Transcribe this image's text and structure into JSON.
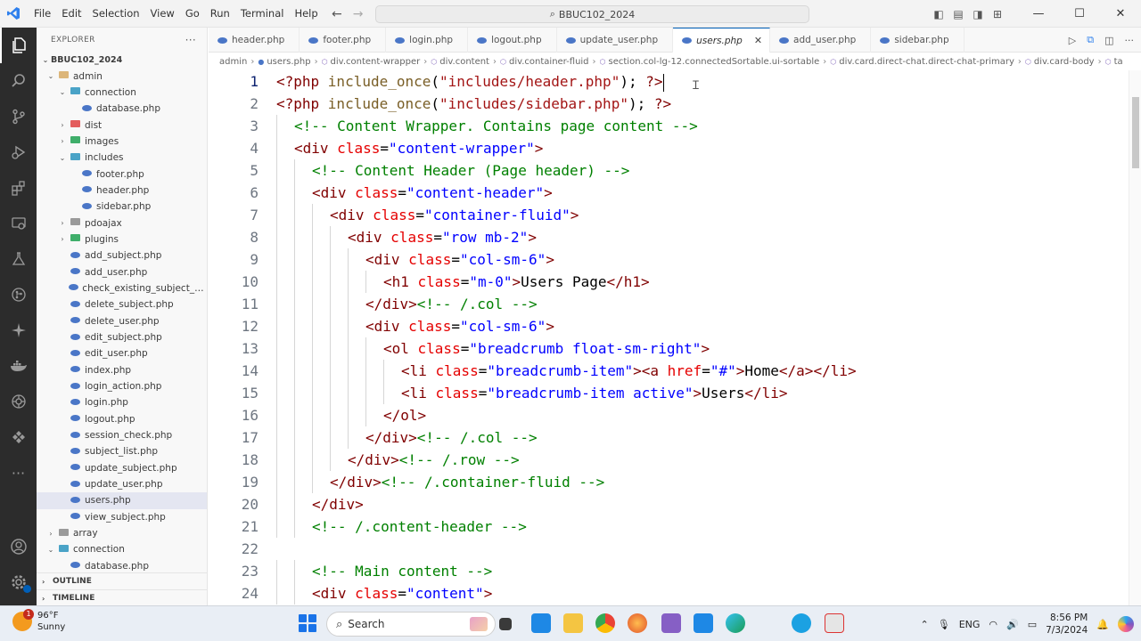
{
  "titlebar": {
    "menu": [
      "File",
      "Edit",
      "Selection",
      "View",
      "Go",
      "Run",
      "Terminal",
      "Help"
    ],
    "search_text": "BBUC102_2024"
  },
  "sidebar": {
    "title": "EXPLORER",
    "more": "···",
    "root": "BBUC102_2024",
    "tree": [
      {
        "label": "admin",
        "type": "folder-open",
        "depth": 0,
        "color": "#dcb67a"
      },
      {
        "label": "connection",
        "type": "folder-open",
        "depth": 1,
        "color": "#4aa3c7"
      },
      {
        "label": "database.php",
        "type": "php",
        "depth": 2
      },
      {
        "label": "dist",
        "type": "folder",
        "depth": 1,
        "color": "#e35d5d"
      },
      {
        "label": "images",
        "type": "folder",
        "depth": 1,
        "color": "#3fae6a"
      },
      {
        "label": "includes",
        "type": "folder-open",
        "depth": 1,
        "color": "#4aa3c7"
      },
      {
        "label": "footer.php",
        "type": "php",
        "depth": 2
      },
      {
        "label": "header.php",
        "type": "php",
        "depth": 2
      },
      {
        "label": "sidebar.php",
        "type": "php",
        "depth": 2
      },
      {
        "label": "pdoajax",
        "type": "folder",
        "depth": 1,
        "color": "#9a9a9a"
      },
      {
        "label": "plugins",
        "type": "folder",
        "depth": 1,
        "color": "#3fae6a"
      },
      {
        "label": "add_subject.php",
        "type": "php",
        "depth": 1
      },
      {
        "label": "add_user.php",
        "type": "php",
        "depth": 1
      },
      {
        "label": "check_existing_subject_cod...",
        "type": "php",
        "depth": 1
      },
      {
        "label": "delete_subject.php",
        "type": "php",
        "depth": 1
      },
      {
        "label": "delete_user.php",
        "type": "php",
        "depth": 1
      },
      {
        "label": "edit_subject.php",
        "type": "php",
        "depth": 1
      },
      {
        "label": "edit_user.php",
        "type": "php",
        "depth": 1
      },
      {
        "label": "index.php",
        "type": "php",
        "depth": 1
      },
      {
        "label": "login_action.php",
        "type": "php",
        "depth": 1
      },
      {
        "label": "login.php",
        "type": "php",
        "depth": 1
      },
      {
        "label": "logout.php",
        "type": "php",
        "depth": 1
      },
      {
        "label": "session_check.php",
        "type": "php",
        "depth": 1
      },
      {
        "label": "subject_list.php",
        "type": "php",
        "depth": 1
      },
      {
        "label": "update_subject.php",
        "type": "php",
        "depth": 1
      },
      {
        "label": "update_user.php",
        "type": "php",
        "depth": 1
      },
      {
        "label": "users.php",
        "type": "php",
        "depth": 1,
        "selected": true
      },
      {
        "label": "view_subject.php",
        "type": "php",
        "depth": 1
      },
      {
        "label": "array",
        "type": "folder",
        "depth": 0,
        "color": "#9a9a9a"
      },
      {
        "label": "connection",
        "type": "folder-open",
        "depth": 0,
        "color": "#4aa3c7"
      },
      {
        "label": "database.php",
        "type": "php",
        "depth": 1
      }
    ],
    "outline": "OUTLINE",
    "timeline": "TIMELINE"
  },
  "tabs": [
    {
      "label": "header.php"
    },
    {
      "label": "footer.php"
    },
    {
      "label": "login.php"
    },
    {
      "label": "logout.php"
    },
    {
      "label": "update_user.php"
    },
    {
      "label": "users.php",
      "active": true
    },
    {
      "label": "add_user.php"
    },
    {
      "label": "sidebar.php"
    }
  ],
  "breadcrumb": [
    "admin",
    "users.php",
    "div.content-wrapper",
    "div.content",
    "div.container-fluid",
    "section.col-lg-12.connectedSortable.ui-sortable",
    "div.card.direct-chat.direct-chat-primary",
    "div.card-body",
    "ta"
  ],
  "editor": {
    "lines": [
      {
        "n": "1",
        "indent": 0,
        "tokens": [
          [
            "php",
            "<?php "
          ],
          [
            "fn",
            "include_once"
          ],
          [
            "txt",
            "("
          ],
          [
            "str",
            "\"includes/header.php\""
          ],
          [
            "txt",
            "); "
          ],
          [
            "php",
            "?>"
          ]
        ],
        "cursor": true
      },
      {
        "n": "2",
        "indent": 0,
        "tokens": [
          [
            "php",
            "<?php "
          ],
          [
            "fn",
            "include_once"
          ],
          [
            "txt",
            "("
          ],
          [
            "str",
            "\"includes/sidebar.php\""
          ],
          [
            "txt",
            "); "
          ],
          [
            "php",
            "?>"
          ]
        ]
      },
      {
        "n": "3",
        "indent": 1,
        "tokens": [
          [
            "com",
            "<!-- Content Wrapper. Contains page content -->"
          ]
        ]
      },
      {
        "n": "4",
        "indent": 1,
        "tokens": [
          [
            "tag",
            "<div "
          ],
          [
            "attr",
            "class"
          ],
          [
            "txt",
            "="
          ],
          [
            "val",
            "\"content-wrapper\""
          ],
          [
            "tag",
            ">"
          ]
        ]
      },
      {
        "n": "5",
        "indent": 2,
        "tokens": [
          [
            "com",
            "<!-- Content Header (Page header) -->"
          ]
        ]
      },
      {
        "n": "6",
        "indent": 2,
        "tokens": [
          [
            "tag",
            "<div "
          ],
          [
            "attr",
            "class"
          ],
          [
            "txt",
            "="
          ],
          [
            "val",
            "\"content-header\""
          ],
          [
            "tag",
            ">"
          ]
        ]
      },
      {
        "n": "7",
        "indent": 3,
        "tokens": [
          [
            "tag",
            "<div "
          ],
          [
            "attr",
            "class"
          ],
          [
            "txt",
            "="
          ],
          [
            "val",
            "\"container-fluid\""
          ],
          [
            "tag",
            ">"
          ]
        ]
      },
      {
        "n": "8",
        "indent": 4,
        "tokens": [
          [
            "tag",
            "<div "
          ],
          [
            "attr",
            "class"
          ],
          [
            "txt",
            "="
          ],
          [
            "val",
            "\"row mb-2\""
          ],
          [
            "tag",
            ">"
          ]
        ]
      },
      {
        "n": "9",
        "indent": 5,
        "tokens": [
          [
            "tag",
            "<div "
          ],
          [
            "attr",
            "class"
          ],
          [
            "txt",
            "="
          ],
          [
            "val",
            "\"col-sm-6\""
          ],
          [
            "tag",
            ">"
          ]
        ]
      },
      {
        "n": "10",
        "indent": 6,
        "tokens": [
          [
            "tag",
            "<h1 "
          ],
          [
            "attr",
            "class"
          ],
          [
            "txt",
            "="
          ],
          [
            "val",
            "\"m-0\""
          ],
          [
            "tag",
            ">"
          ],
          [
            "txt",
            "Users Page"
          ],
          [
            "tag",
            "</h1>"
          ]
        ]
      },
      {
        "n": "11",
        "indent": 5,
        "tokens": [
          [
            "tag",
            "</div>"
          ],
          [
            "com",
            "<!-- /.col -->"
          ]
        ]
      },
      {
        "n": "12",
        "indent": 5,
        "tokens": [
          [
            "tag",
            "<div "
          ],
          [
            "attr",
            "class"
          ],
          [
            "txt",
            "="
          ],
          [
            "val",
            "\"col-sm-6\""
          ],
          [
            "tag",
            ">"
          ]
        ]
      },
      {
        "n": "13",
        "indent": 6,
        "tokens": [
          [
            "tag",
            "<ol "
          ],
          [
            "attr",
            "class"
          ],
          [
            "txt",
            "="
          ],
          [
            "val",
            "\"breadcrumb float-sm-right\""
          ],
          [
            "tag",
            ">"
          ]
        ]
      },
      {
        "n": "14",
        "indent": 7,
        "tokens": [
          [
            "tag",
            "<li "
          ],
          [
            "attr",
            "class"
          ],
          [
            "txt",
            "="
          ],
          [
            "val",
            "\"breadcrumb-item\""
          ],
          [
            "tag",
            ">"
          ],
          [
            "tag",
            "<a "
          ],
          [
            "attr",
            "href"
          ],
          [
            "txt",
            "="
          ],
          [
            "val",
            "\"#\""
          ],
          [
            "tag",
            ">"
          ],
          [
            "txt",
            "Home"
          ],
          [
            "tag",
            "</a></li>"
          ]
        ]
      },
      {
        "n": "15",
        "indent": 7,
        "tokens": [
          [
            "tag",
            "<li "
          ],
          [
            "attr",
            "class"
          ],
          [
            "txt",
            "="
          ],
          [
            "val",
            "\"breadcrumb-item active\""
          ],
          [
            "tag",
            ">"
          ],
          [
            "txt",
            "Users"
          ],
          [
            "tag",
            "</li>"
          ]
        ]
      },
      {
        "n": "16",
        "indent": 6,
        "tokens": [
          [
            "tag",
            "</ol>"
          ]
        ]
      },
      {
        "n": "17",
        "indent": 5,
        "tokens": [
          [
            "tag",
            "</div>"
          ],
          [
            "com",
            "<!-- /.col -->"
          ]
        ]
      },
      {
        "n": "18",
        "indent": 4,
        "tokens": [
          [
            "tag",
            "</div>"
          ],
          [
            "com",
            "<!-- /.row -->"
          ]
        ]
      },
      {
        "n": "19",
        "indent": 3,
        "tokens": [
          [
            "tag",
            "</div>"
          ],
          [
            "com",
            "<!-- /.container-fluid -->"
          ]
        ]
      },
      {
        "n": "20",
        "indent": 2,
        "tokens": [
          [
            "tag",
            "</div>"
          ]
        ]
      },
      {
        "n": "21",
        "indent": 2,
        "tokens": [
          [
            "com",
            "<!-- /.content-header -->"
          ]
        ]
      },
      {
        "n": "22",
        "indent": 0,
        "tokens": []
      },
      {
        "n": "23",
        "indent": 2,
        "tokens": [
          [
            "com",
            "<!-- Main content -->"
          ]
        ]
      },
      {
        "n": "24",
        "indent": 2,
        "tokens": [
          [
            "tag",
            "<div "
          ],
          [
            "attr",
            "class"
          ],
          [
            "txt",
            "="
          ],
          [
            "val",
            "\"content\""
          ],
          [
            "tag",
            ">"
          ]
        ]
      }
    ]
  },
  "taskbar": {
    "temp": "96°F",
    "weather": "Sunny",
    "weather_badge": "1",
    "search_label": "Search",
    "lang": "ENG",
    "time": "8:56 PM",
    "date": "7/3/2024"
  }
}
